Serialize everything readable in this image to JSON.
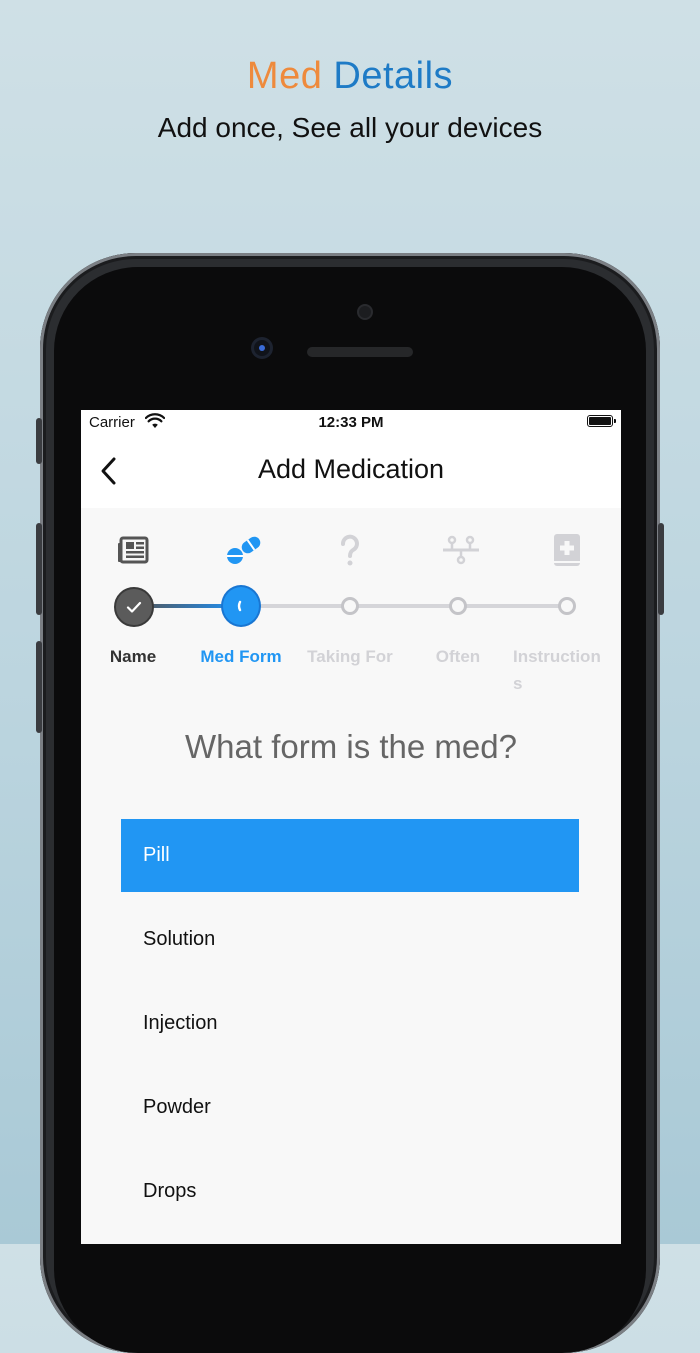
{
  "promo": {
    "title_word1": "Med",
    "title_word2": "Details",
    "subtitle": "Add once, See all your devices"
  },
  "status_bar": {
    "carrier": "Carrier",
    "time": "12:33 PM"
  },
  "nav": {
    "title": "Add Medication"
  },
  "stepper": {
    "steps": [
      {
        "label": "Name",
        "state": "done",
        "icon": "newspaper-icon"
      },
      {
        "label": "Med Form",
        "state": "active",
        "icon": "pills-icon"
      },
      {
        "label": "Taking For",
        "state": "todo",
        "icon": "question-icon"
      },
      {
        "label": "Often",
        "state": "todo",
        "icon": "timeline-icon"
      },
      {
        "label": "Instruction",
        "state": "todo",
        "icon": "medical-book-icon"
      }
    ],
    "last_label_wrap": "s"
  },
  "question": "What form is the med?",
  "options": [
    {
      "label": "Pill",
      "selected": true
    },
    {
      "label": "Solution",
      "selected": false
    },
    {
      "label": "Injection",
      "selected": false
    },
    {
      "label": "Powder",
      "selected": false
    },
    {
      "label": "Drops",
      "selected": false
    }
  ],
  "colors": {
    "accent": "#2196f3",
    "brand_orange": "#ee8a3c",
    "brand_blue": "#1e7bc6",
    "inactive": "#c4c4c8"
  }
}
